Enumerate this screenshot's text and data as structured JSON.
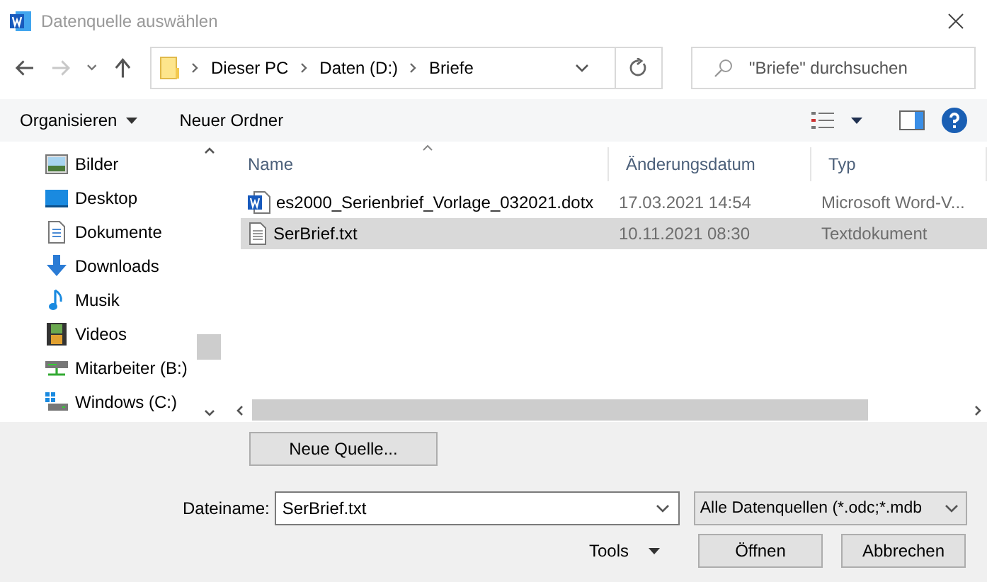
{
  "window": {
    "title": "Datenquelle auswählen"
  },
  "address_bar": {
    "path": [
      "Dieser PC",
      "Daten (D:)",
      "Briefe"
    ]
  },
  "search": {
    "placeholder": "\"Briefe\" durchsuchen"
  },
  "toolbar": {
    "organize": "Organisieren",
    "new_folder": "Neuer Ordner"
  },
  "nav_pane": {
    "items": [
      {
        "label": "Bilder",
        "kind": "pictures"
      },
      {
        "label": "Desktop",
        "kind": "desktop"
      },
      {
        "label": "Dokumente",
        "kind": "documents"
      },
      {
        "label": "Downloads",
        "kind": "downloads"
      },
      {
        "label": "Musik",
        "kind": "music"
      },
      {
        "label": "Videos",
        "kind": "videos"
      },
      {
        "label": "Mitarbeiter (B:)",
        "kind": "network"
      },
      {
        "label": "Windows (C:)",
        "kind": "system"
      }
    ]
  },
  "file_list": {
    "columns": [
      "Name",
      "Änderungsdatum",
      "Typ"
    ],
    "rows": [
      {
        "name": "es2000_Serienbrief_Vorlage_032021.dotx",
        "date": "17.03.2021 14:54",
        "type": "Microsoft Word-V...",
        "kind": "word",
        "selected": false
      },
      {
        "name": "SerBrief.txt",
        "date": "10.11.2021 08:30",
        "type": "Textdokument",
        "kind": "text",
        "selected": true
      }
    ]
  },
  "new_source_button": "Neue Quelle...",
  "filename": {
    "label": "Dateiname:",
    "value": "SerBrief.txt"
  },
  "filter": {
    "value": "Alle Datenquellen (*.odc;*.mdb"
  },
  "buttons": {
    "tools": "Tools",
    "open": "Öffnen",
    "cancel": "Abbrechen"
  }
}
